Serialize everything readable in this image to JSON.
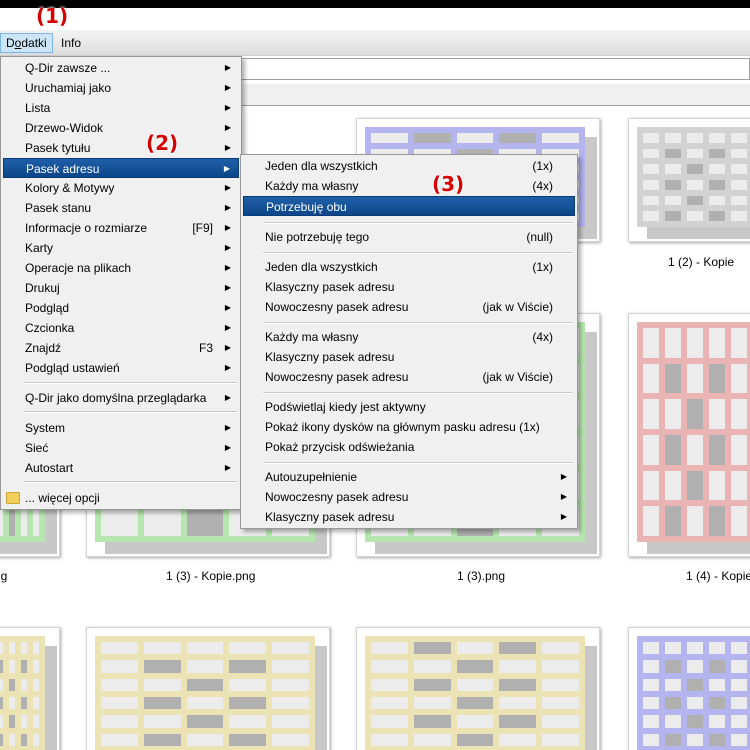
{
  "menubar": {
    "items": [
      {
        "label": "Dodatki"
      },
      {
        "label": "Info"
      }
    ]
  },
  "annotations": {
    "one": "(1)",
    "two": "(2)",
    "three": "(3)"
  },
  "menu1": {
    "items": [
      {
        "label": "Q-Dir zawsze ...",
        "shortcut": "",
        "arrow": true
      },
      {
        "label": "Uruchamiaj jako",
        "shortcut": "",
        "arrow": true
      },
      {
        "label": "Lista",
        "shortcut": "",
        "arrow": true
      },
      {
        "label": "Drzewo-Widok",
        "shortcut": "",
        "arrow": true
      },
      {
        "label": "Pasek tytułu",
        "shortcut": "",
        "arrow": true
      },
      {
        "label": "Pasek adresu",
        "shortcut": "",
        "arrow": true
      },
      {
        "label": "Kolory & Motywy",
        "shortcut": "",
        "arrow": true
      },
      {
        "label": "Pasek stanu",
        "shortcut": "",
        "arrow": true
      },
      {
        "label": "Informacje o rozmiarze",
        "shortcut": "[F9]",
        "arrow": true
      },
      {
        "label": "Karty",
        "shortcut": "",
        "arrow": true
      },
      {
        "label": "Operacje na plikach",
        "shortcut": "",
        "arrow": true
      },
      {
        "label": "Drukuj",
        "shortcut": "",
        "arrow": true
      },
      {
        "label": "Podgląd",
        "shortcut": "",
        "arrow": true
      },
      {
        "label": "Czcionka",
        "shortcut": "",
        "arrow": true
      },
      {
        "label": "Znajdź",
        "shortcut": "F3",
        "arrow": true
      },
      {
        "label": "Podgląd ustawień",
        "shortcut": "",
        "arrow": true
      },
      {
        "label": "Q-Dir jako domyślna przeglądarka",
        "shortcut": "",
        "arrow": true
      },
      {
        "label": "System",
        "shortcut": "",
        "arrow": true
      },
      {
        "label": "Sieć",
        "shortcut": "",
        "arrow": true
      },
      {
        "label": "Autostart",
        "shortcut": "",
        "arrow": true
      },
      {
        "label": "... więcej opcji",
        "shortcut": "",
        "arrow": false
      }
    ]
  },
  "menu2": {
    "items": [
      {
        "label": "Jeden dla wszystkich",
        "shortcut": "(1x)",
        "arrow": false
      },
      {
        "label": "Każdy ma własny",
        "shortcut": "(4x)",
        "arrow": false
      },
      {
        "label": "Potrzebuję obu",
        "shortcut": "",
        "arrow": false
      },
      {
        "label": "Nie potrzebuję tego",
        "shortcut": "(null)",
        "arrow": false
      },
      {
        "label": "Jeden dla wszystkich",
        "shortcut": "(1x)",
        "arrow": false
      },
      {
        "label": "Klasyczny pasek adresu",
        "shortcut": "",
        "arrow": false
      },
      {
        "label": "Nowoczesny pasek adresu",
        "shortcut": "(jak w Viście)",
        "arrow": false
      },
      {
        "label": "Każdy ma własny",
        "shortcut": "(4x)",
        "arrow": false
      },
      {
        "label": "Klasyczny pasek adresu",
        "shortcut": "",
        "arrow": false
      },
      {
        "label": "Nowoczesny pasek adresu",
        "shortcut": "(jak w Viście)",
        "arrow": false
      },
      {
        "label": "Podświetlaj kiedy jest aktywny",
        "shortcut": "",
        "arrow": false
      },
      {
        "label": "Pokaż ikony dysków na głównym pasku adresu (1x)",
        "shortcut": "",
        "arrow": false
      },
      {
        "label": "Pokaż przycisk odświeżania",
        "shortcut": "",
        "arrow": false
      },
      {
        "label": "Autouzupełnienie",
        "shortcut": "",
        "arrow": true
      },
      {
        "label": "Nowoczesny pasek adresu",
        "shortcut": "",
        "arrow": true
      },
      {
        "label": "Klasyczny pasek adresu",
        "shortcut": "",
        "arrow": true
      }
    ]
  },
  "files": {
    "captions": [
      "1 (2) - Kopie",
      "ng",
      "1 (3) - Kopie.png",
      "1 (3).png",
      "1 (4) - Kopie"
    ]
  },
  "colors": {
    "menu_highlight": "#0d4689",
    "annotation": "#d80000",
    "thumb_blue": "#b4b4ee",
    "thumb_gray": "#d2d2d2",
    "thumb_green": "#b7e6b0",
    "thumb_red": "#eab4b4",
    "thumb_yellow": "#ebe3b3"
  }
}
